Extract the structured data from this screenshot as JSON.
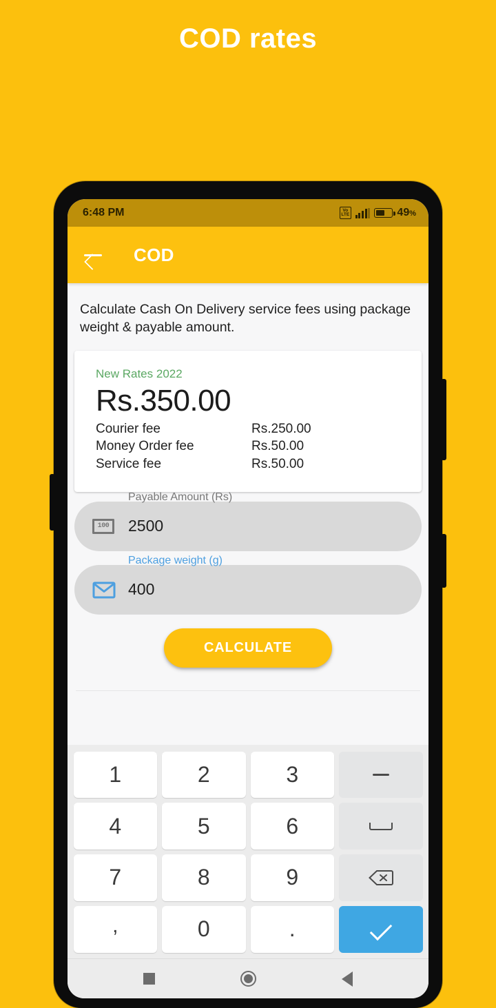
{
  "page": {
    "title": "COD rates",
    "background_color": "#FCC00D"
  },
  "phone": {
    "statusbar": {
      "time": "6:48 PM",
      "volte_line1": "Vo",
      "volte_line2": "LTE",
      "battery_percent": "49",
      "battery_percent_symbol": "%",
      "background_color": "#bd8f0a"
    },
    "appbar": {
      "title": "COD",
      "back_icon": "arrow-left-icon",
      "background_color": "#FDC10F"
    },
    "content": {
      "description": "Calculate Cash On Delivery service fees using package weight & payable amount.",
      "rates_card": {
        "label": "New Rates 2022",
        "label_color": "#5BA863",
        "total": "Rs.350.00",
        "rows": [
          {
            "name": "Courier fee",
            "value": "Rs.250.00"
          },
          {
            "name": "Money Order fee",
            "value": "Rs.50.00"
          },
          {
            "name": "Service fee",
            "value": "Rs.50.00"
          }
        ]
      },
      "fields": [
        {
          "label": "Payable Amount (Rs)",
          "value": "2500",
          "icon": "banknote-icon",
          "icon_text": "100",
          "state": "inactive",
          "label_color": "#777777"
        },
        {
          "label": "Package weight (g)",
          "value": "400",
          "icon": "envelope-icon",
          "state": "active",
          "label_color": "#4D9FE0"
        }
      ],
      "calculate_button": {
        "label": "CALCULATE",
        "background_color": "#FDC10F",
        "text_color": "#FFFFFF"
      }
    },
    "keyboard": {
      "accent_color": "#3FA7E3",
      "rows": [
        [
          {
            "label": "1",
            "type": "digit",
            "name": "key-1"
          },
          {
            "label": "2",
            "type": "digit",
            "name": "key-2"
          },
          {
            "label": "3",
            "type": "digit",
            "name": "key-3"
          },
          {
            "label": "",
            "type": "minus",
            "name": "key-minus"
          }
        ],
        [
          {
            "label": "4",
            "type": "digit",
            "name": "key-4"
          },
          {
            "label": "5",
            "type": "digit",
            "name": "key-5"
          },
          {
            "label": "6",
            "type": "digit",
            "name": "key-6"
          },
          {
            "label": "",
            "type": "space",
            "name": "key-space"
          }
        ],
        [
          {
            "label": "7",
            "type": "digit",
            "name": "key-7"
          },
          {
            "label": "8",
            "type": "digit",
            "name": "key-8"
          },
          {
            "label": "9",
            "type": "digit",
            "name": "key-9"
          },
          {
            "label": "",
            "type": "backspace",
            "name": "key-backspace"
          }
        ],
        [
          {
            "label": ",",
            "type": "comma",
            "name": "key-comma"
          },
          {
            "label": "0",
            "type": "digit",
            "name": "key-0"
          },
          {
            "label": ".",
            "type": "period",
            "name": "key-period"
          },
          {
            "label": "",
            "type": "enter",
            "name": "key-enter"
          }
        ]
      ]
    },
    "navbar": {
      "recents": "square-icon",
      "home": "circle-icon",
      "back": "triangle-back-icon"
    }
  }
}
